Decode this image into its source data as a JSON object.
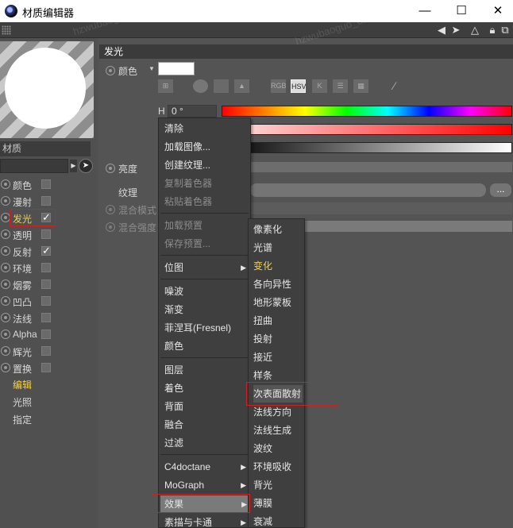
{
  "window": {
    "title": "材质编辑器",
    "minimize": "—",
    "maximize": "☐",
    "close": "✕"
  },
  "watermark": "hzwubaoguo_ua",
  "toolbar": {
    "icons": [
      "back-arrow-icon",
      "cursor-icon",
      "triangle-icon",
      "lock-icon",
      "new-window-icon"
    ]
  },
  "material": {
    "label": "材质",
    "channels": [
      {
        "label": "颜色",
        "checked": false
      },
      {
        "label": "漫射",
        "checked": false
      },
      {
        "label": "发光",
        "checked": true,
        "active": true
      },
      {
        "label": "透明",
        "checked": false
      },
      {
        "label": "反射",
        "checked": true
      },
      {
        "label": "环境",
        "checked": false
      },
      {
        "label": "烟雾",
        "checked": false
      },
      {
        "label": "凹凸",
        "checked": false
      },
      {
        "label": "法线",
        "checked": false
      },
      {
        "label": "Alpha",
        "checked": false
      },
      {
        "label": "辉光",
        "checked": false
      },
      {
        "label": "置换",
        "checked": false
      }
    ],
    "sub": [
      "编辑",
      "光照",
      "指定"
    ]
  },
  "glow": {
    "section": "发光",
    "color_label": "颜色",
    "color_value": "#ffffff",
    "modes": [
      "RGB",
      "HSV",
      "K"
    ],
    "h_label": "H",
    "h_value": "0 °",
    "brightness_label": "亮度",
    "texture_label": "纹理",
    "texture_btn": "...",
    "blend_mode_label": "混合模式",
    "blend_strength_label": "混合强度"
  },
  "menu1": {
    "items": [
      {
        "label": "清除"
      },
      {
        "label": "加载图像..."
      },
      {
        "label": "创建纹理..."
      },
      {
        "label": "复制着色器",
        "disabled": true
      },
      {
        "label": "粘贴着色器",
        "disabled": true
      },
      {
        "label": "加载预置",
        "disabled": true
      },
      {
        "label": "保存预置...",
        "disabled": true
      },
      {
        "label": "位图"
      },
      {
        "label": "噪波"
      },
      {
        "label": "渐变"
      },
      {
        "label": "菲涅耳(Fresnel)"
      },
      {
        "label": "颜色"
      },
      {
        "label": "图层"
      },
      {
        "label": "着色"
      },
      {
        "label": "背面"
      },
      {
        "label": "融合"
      },
      {
        "label": "过滤"
      },
      {
        "label": "C4doctane"
      },
      {
        "label": "MoGraph"
      },
      {
        "label": "效果"
      },
      {
        "label": "素描与卡通"
      }
    ]
  },
  "menu2": {
    "items": [
      "像素化",
      "光谱",
      "变化",
      "各向异性",
      "地形蒙板",
      "扭曲",
      "投射",
      "接近",
      "样条",
      "次表面散射",
      "法线方向",
      "法线生成",
      "波纹",
      "环境吸收",
      "背光",
      "薄膜",
      "衰减"
    ]
  }
}
